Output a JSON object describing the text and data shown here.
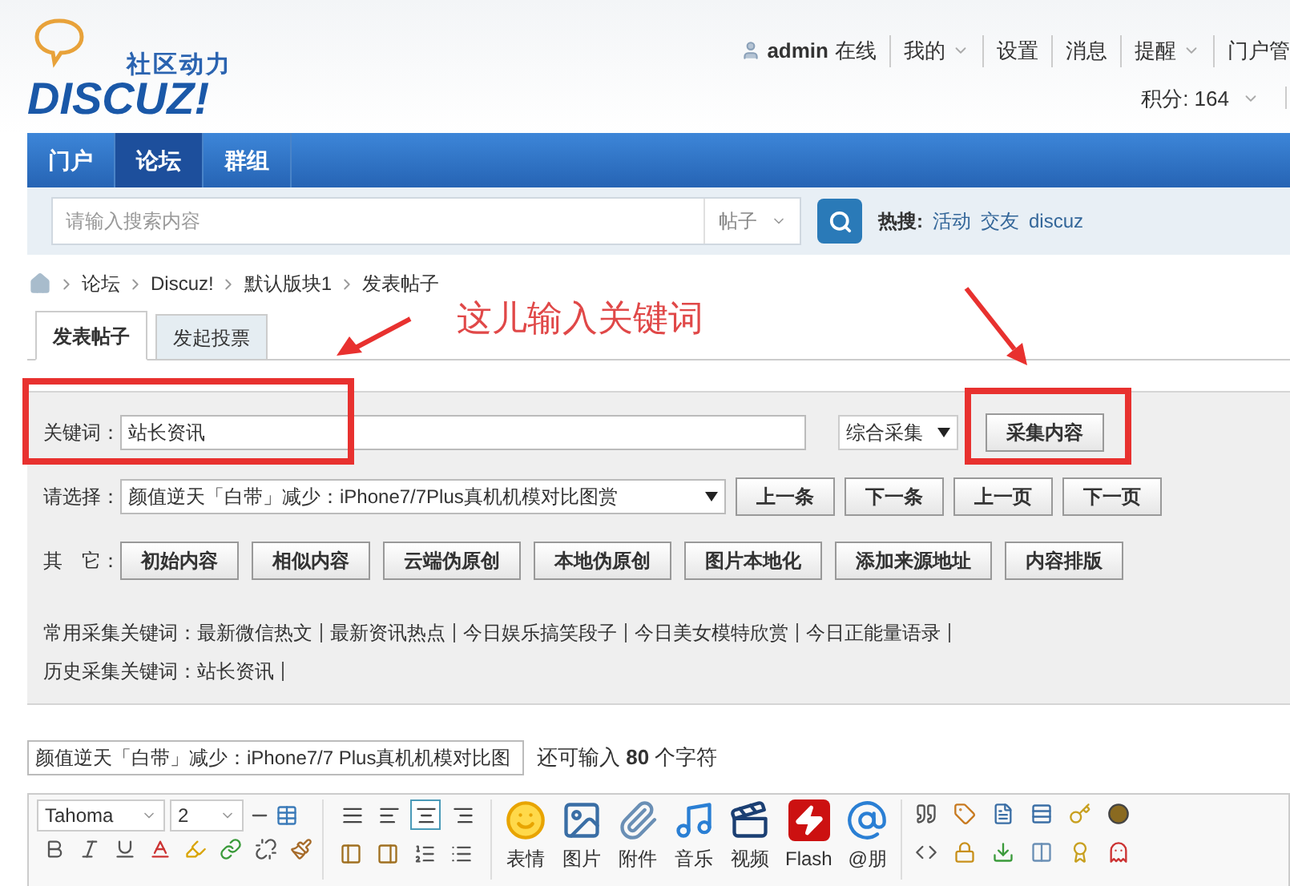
{
  "header": {
    "logo_tagline": "社区动力",
    "logo_text": "DISCUZ!",
    "user": {
      "name": "admin",
      "status": "在线"
    },
    "user_menu": [
      {
        "label": "我的",
        "dropdown": true
      },
      {
        "label": "设置",
        "dropdown": false
      },
      {
        "label": "消息",
        "dropdown": false
      },
      {
        "label": "提醒",
        "dropdown": true
      },
      {
        "label": "门户管",
        "dropdown": false
      }
    ],
    "credits": "积分: 164"
  },
  "nav": [
    {
      "label": "门户",
      "selected": false
    },
    {
      "label": "论坛",
      "selected": true
    },
    {
      "label": "群组",
      "selected": false
    }
  ],
  "search": {
    "placeholder": "请输入搜索内容",
    "scope": "帖子",
    "hot_label": "热搜:",
    "hot_links": [
      "活动",
      "交友",
      "discuz"
    ]
  },
  "breadcrumb": [
    "论坛",
    "Discuz!",
    "默认版块1",
    "发表帖子"
  ],
  "tabs": [
    {
      "label": "发表帖子",
      "selected": true
    },
    {
      "label": "发起投票",
      "selected": false
    }
  ],
  "collector": {
    "keyword_label": "关键词：",
    "keyword": "站长资讯",
    "mode": "综合采集",
    "collect_button": "采集内容",
    "select_label": "请选择：",
    "selected_article": "颜值逆天「白带」减少：iPhone7/7Plus真机机模对比图赏",
    "nav_buttons": [
      "上一条",
      "下一条",
      "上一页",
      "下一页"
    ],
    "other_label": "其　它：",
    "other_buttons": [
      "初始内容",
      "相似内容",
      "云端伪原创",
      "本地伪原创",
      "图片本地化",
      "添加来源地址",
      "内容排版"
    ],
    "common_label": "常用采集关键词：",
    "common_keywords": [
      "最新微信热文",
      "最新资讯热点",
      "今日娱乐搞笑段子",
      "今日美女模特欣赏",
      "今日正能量语录"
    ],
    "history_label": "历史采集关键词：",
    "history_keywords": [
      "站长资讯"
    ]
  },
  "annotation": {
    "text": "这儿输入关键词"
  },
  "title_field": {
    "value": "颜值逆天「白带」减少：iPhone7/7 Plus真机机模对比图",
    "counter": "还可输入 **80** 个字符"
  },
  "editor": {
    "font": "Tahoma",
    "size": "2",
    "align_tools": [
      {
        "selected": false
      },
      {
        "selected": false
      },
      {
        "selected": true
      },
      {
        "selected": false
      }
    ],
    "media_tools": [
      "表情",
      "图片",
      "附件",
      "音乐",
      "视频",
      "Flash",
      "@朋"
    ]
  }
}
